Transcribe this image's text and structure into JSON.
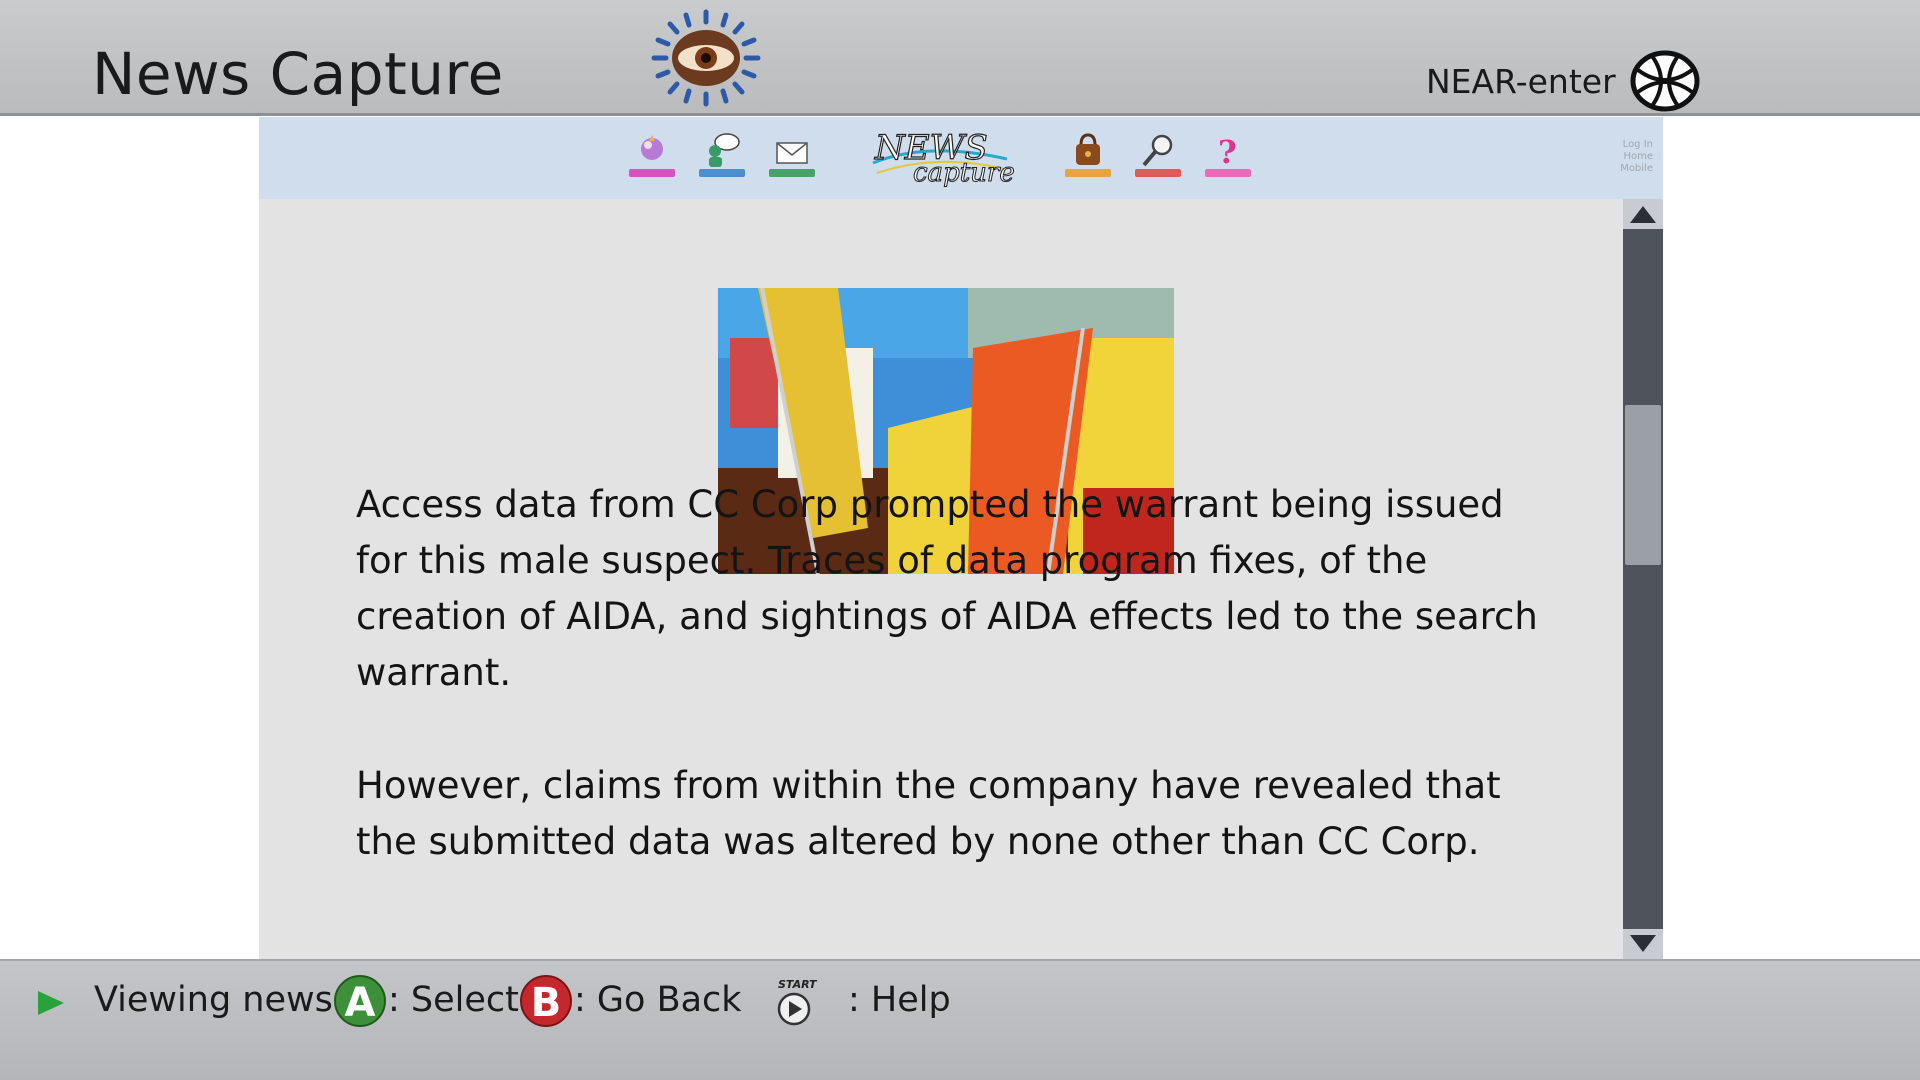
{
  "window": {
    "title": "News Capture",
    "status_label": "NEAR-enter"
  },
  "icons": {
    "emblem": "eye-emblem-icon",
    "globe": "globe-icon",
    "nav": [
      "profile-icon",
      "chat-icon",
      "mail-icon",
      "shop-bag-icon",
      "search-icon",
      "help-icon"
    ],
    "logo": "news-capture-logo"
  },
  "site_nav": {
    "logo_top": "NEWS",
    "logo_bottom": "capture",
    "mini_links": [
      "Log In",
      "Home",
      "Mobile"
    ]
  },
  "article": {
    "image_alt": "protest banners",
    "paragraphs": [
      "Access data from CC Corp prompted the warrant being issued for this male suspect. Traces of data program fixes, of the creation of AIDA, and sightings of AIDA effects led to the search warrant.",
      "However, claims from within the company have revealed that the submitted data was altered by none other than CC Corp."
    ]
  },
  "bottom_bar": {
    "status": "Viewing news.",
    "a_button": "A",
    "a_label": ": Select",
    "b_button": "B",
    "b_label": ": Go Back",
    "start_button": "START",
    "start_label": ": Help"
  },
  "colors": {
    "topbar": "#c0c2c4",
    "sitenav": "#cfdded",
    "content_bg": "#e3e3e3",
    "scrollbar": "#4f545c",
    "a_button": "#3d8f3a",
    "b_button": "#c3282d",
    "play_arrow": "#2aa23a"
  }
}
